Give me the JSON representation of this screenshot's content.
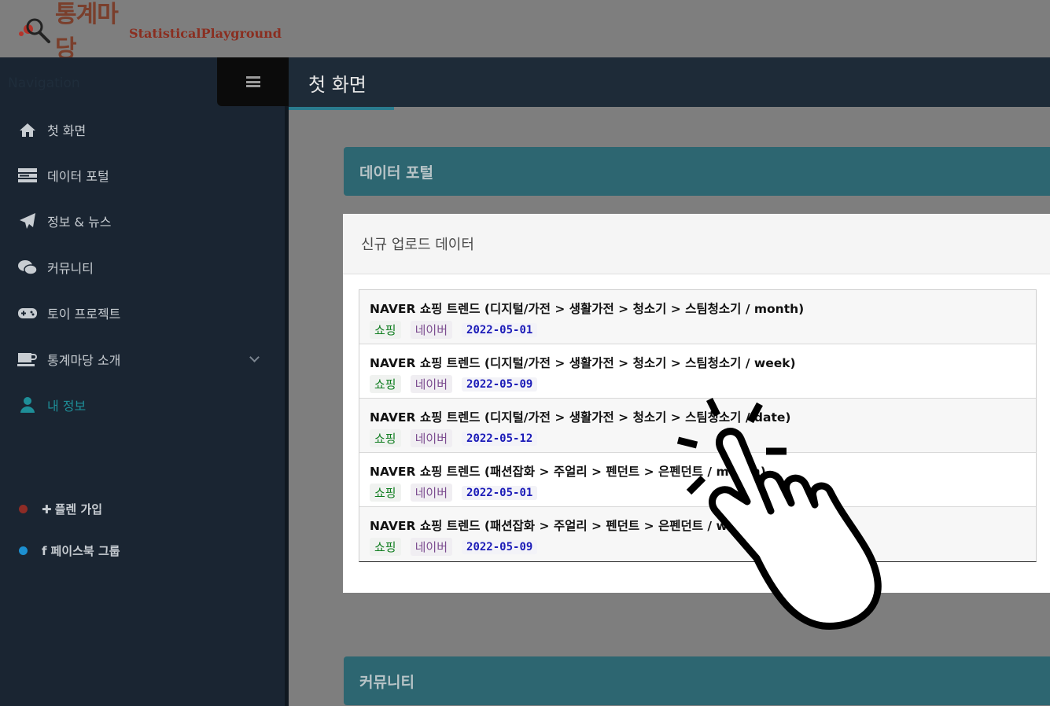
{
  "logo": {
    "korean": "통계마당",
    "english": "StatisticalPlayground"
  },
  "sidebar": {
    "nav_title": "Navigation",
    "items": [
      {
        "label": "첫 화면",
        "icon": "home-icon"
      },
      {
        "label": "데이터 포털",
        "icon": "server-icon"
      },
      {
        "label": "정보 & 뉴스",
        "icon": "paper-plane-icon"
      },
      {
        "label": "커뮤니티",
        "icon": "chat-bubbles-icon"
      },
      {
        "label": "토이 프로젝트",
        "icon": "gamepad-icon"
      },
      {
        "label": "통계마당 소개",
        "icon": "coffee-cup-icon"
      },
      {
        "label": "내 정보",
        "icon": "user-icon"
      }
    ],
    "external": [
      {
        "label": "플렌 가입",
        "prefix": "✚",
        "color": "#b6382f"
      },
      {
        "label": "페이스북 그룹",
        "prefix": "f",
        "color": "#1c8fd0"
      }
    ]
  },
  "header": {
    "title": "첫 화면"
  },
  "sections": {
    "data_portal": "데이터 포털",
    "community": "커뮤니티"
  },
  "card": {
    "title": "신규 업로드 데이터",
    "rows": [
      {
        "title": "NAVER 쇼핑 트렌드 (디지털/가전 > 생활가전 > 청소기 > 스팀청소기 / month)",
        "category": "쇼핑",
        "source": "네이버",
        "date": "2022-05-01"
      },
      {
        "title": "NAVER 쇼핑 트렌드 (디지털/가전 > 생활가전 > 청소기 > 스팀청소기 / week)",
        "category": "쇼핑",
        "source": "네이버",
        "date": "2022-05-09"
      },
      {
        "title": "NAVER 쇼핑 트렌드 (디지털/가전 > 생활가전 > 청소기 > 스팀청소기 / date)",
        "category": "쇼핑",
        "source": "네이버",
        "date": "2022-05-12"
      },
      {
        "title": "NAVER 쇼핑 트렌드 (패션잡화 > 주얼리 > 펜던트 > 은펜던트 / month)",
        "category": "쇼핑",
        "source": "네이버",
        "date": "2022-05-01"
      },
      {
        "title": "NAVER 쇼핑 트렌드 (패션잡화 > 주얼리 > 펜던트 > 은펜던트 / week)",
        "category": "쇼핑",
        "source": "네이버",
        "date": "2022-05-09"
      }
    ]
  },
  "colors": {
    "sidebar": "#1a2532",
    "accent": "#2d6671",
    "active": "#1e8e98"
  }
}
